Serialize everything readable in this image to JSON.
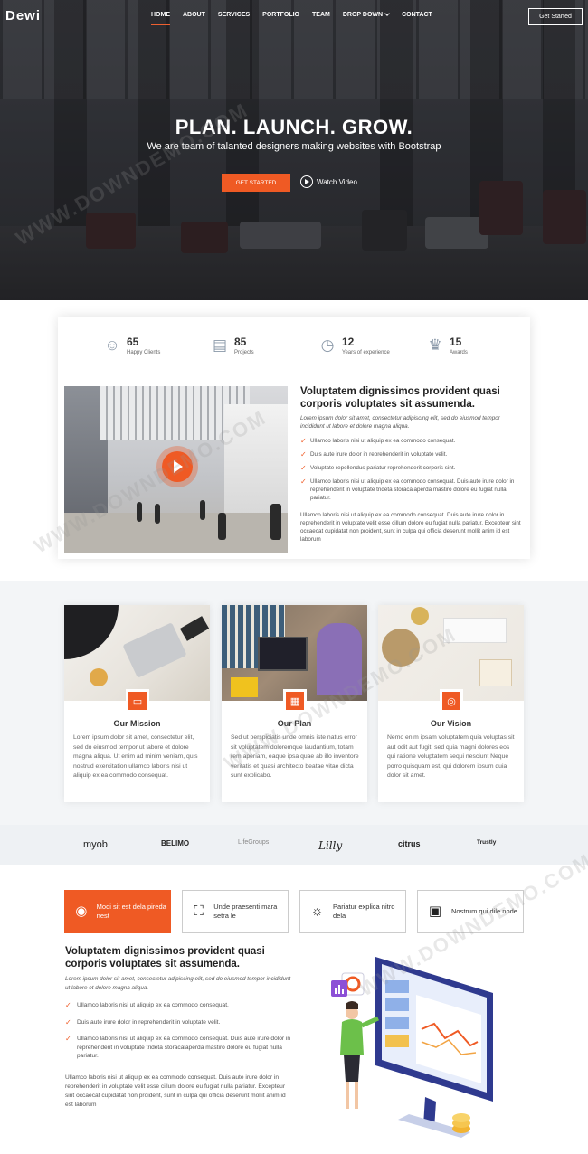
{
  "header": {
    "logo": "Dewi",
    "nav": [
      {
        "label": "HOME",
        "active": true
      },
      {
        "label": "ABOUT"
      },
      {
        "label": "SERVICES"
      },
      {
        "label": "PORTFOLIO"
      },
      {
        "label": "TEAM"
      },
      {
        "label": "DROP DOWN",
        "dropdown": true
      },
      {
        "label": "CONTACT"
      }
    ],
    "cta": "Get Started"
  },
  "hero": {
    "title": "PLAN. LAUNCH. GROW.",
    "subtitle": "We are team of talanted designers making websites with Bootstrap",
    "button": "GET STARTED",
    "watch_video": "Watch Video"
  },
  "stats": [
    {
      "icon": "smiley-icon",
      "value": "65",
      "label": "Happy Clients"
    },
    {
      "icon": "printer-icon",
      "value": "85",
      "label": "Projects"
    },
    {
      "icon": "clock-icon",
      "value": "12",
      "label": "Years of experience"
    },
    {
      "icon": "trophy-icon",
      "value": "15",
      "label": "Awards"
    }
  ],
  "about": {
    "title": "Voluptatem dignissimos provident quasi corporis voluptates sit assumenda.",
    "lead": "Lorem ipsum dolor sit amet, consectetur adipiscing elit, sed do eiusmod tempor incididunt ut labore et dolore magna aliqua.",
    "items": [
      "Ullamco laboris nisi ut aliquip ex ea commodo consequat.",
      "Duis aute irure dolor in reprehenderit in voluptate velit.",
      "Voluptate repellendus pariatur reprehenderit corporis sint.",
      "Ullamco laboris nisi ut aliquip ex ea commodo consequat. Duis aute irure dolor in reprehenderit in voluptate trideta storacalaperda mastiro dolore eu fugiat nulla pariatur."
    ],
    "paragraph": "Ullamco laboris nisi ut aliquip ex ea commodo consequat. Duis aute irure dolor in reprehenderit in voluptate velit esse cillum dolore eu fugiat nulla pariatur. Excepteur sint occaecat cupidatat non proident, sunt in culpa qui officia deserunt mollit anim id est laborum"
  },
  "features": [
    {
      "title": "Our Mission",
      "icon": "screen-icon",
      "desc": "Lorem ipsum dolor sit amet, consectetur elit, sed do eiusmod tempor ut labore et dolore magna aliqua. Ut enim ad minim veniam, quis nostrud exercitation ullamco laboris nisi ut aliquip ex ea commodo consequat."
    },
    {
      "title": "Our Plan",
      "icon": "calendar-icon",
      "desc": "Sed ut perspiciatis unde omnis iste natus error sit voluptatem doloremque laudantium, totam rem aperiam, eaque ipsa quae ab illo inventore veritatis et quasi architecto beatae vitae dicta sunt explicabo."
    },
    {
      "title": "Our Vision",
      "icon": "target-icon",
      "desc": "Nemo enim ipsam voluptatem quia voluptas sit aut odit aut fugit, sed quia magni dolores eos qui ratione voluptatem sequi nesciunt Neque porro quisquam est, qui dolorem ipsum quia dolor sit amet."
    }
  ],
  "clients": [
    "myob",
    "BELIMO",
    "LifeGroups",
    "Lilly",
    "citrus",
    "Trustly"
  ],
  "tabs": [
    {
      "label": "Modi sit est dela pireda nest",
      "icon": "broadcast-icon",
      "active": true
    },
    {
      "label": "Unde praesenti mara setra le",
      "icon": "scan-icon"
    },
    {
      "label": "Pariatur explica nitro dela",
      "icon": "sun-icon"
    },
    {
      "label": "Nostrum qui dile node",
      "icon": "window-icon"
    }
  ],
  "tab_content": {
    "title": "Voluptatem dignissimos provident quasi corporis voluptates sit assumenda.",
    "lead": "Lorem ipsum dolor sit amet, consectetur adipiscing elit, sed do eiusmod tempor incididunt ut labore et dolore magna aliqua.",
    "items": [
      "Ullamco laboris nisi ut aliquip ex ea commodo consequat.",
      "Duis aute irure dolor in reprehenderit in voluptate velit.",
      "Ullamco laboris nisi ut aliquip ex ea commodo consequat. Duis aute irure dolor in reprehenderit in voluptate trideta storacalaperda mastiro dolore eu fugiat nulla pariatur."
    ],
    "paragraph": "Ullamco laboris nisi ut aliquip ex ea commodo consequat. Duis aute irure dolor in reprehenderit in voluptate velit esse cillum dolore eu fugiat nulla pariatur. Excepteur sint occaecat cupidatat non proident, sunt in culpa qui officia deserunt mollit anim id est laborum"
  },
  "watermark": "WWW.DOWNDEMO.COM",
  "colors": {
    "accent": "#ef5a24",
    "text": "#444444",
    "feature_bg": "#f3f5f7"
  }
}
